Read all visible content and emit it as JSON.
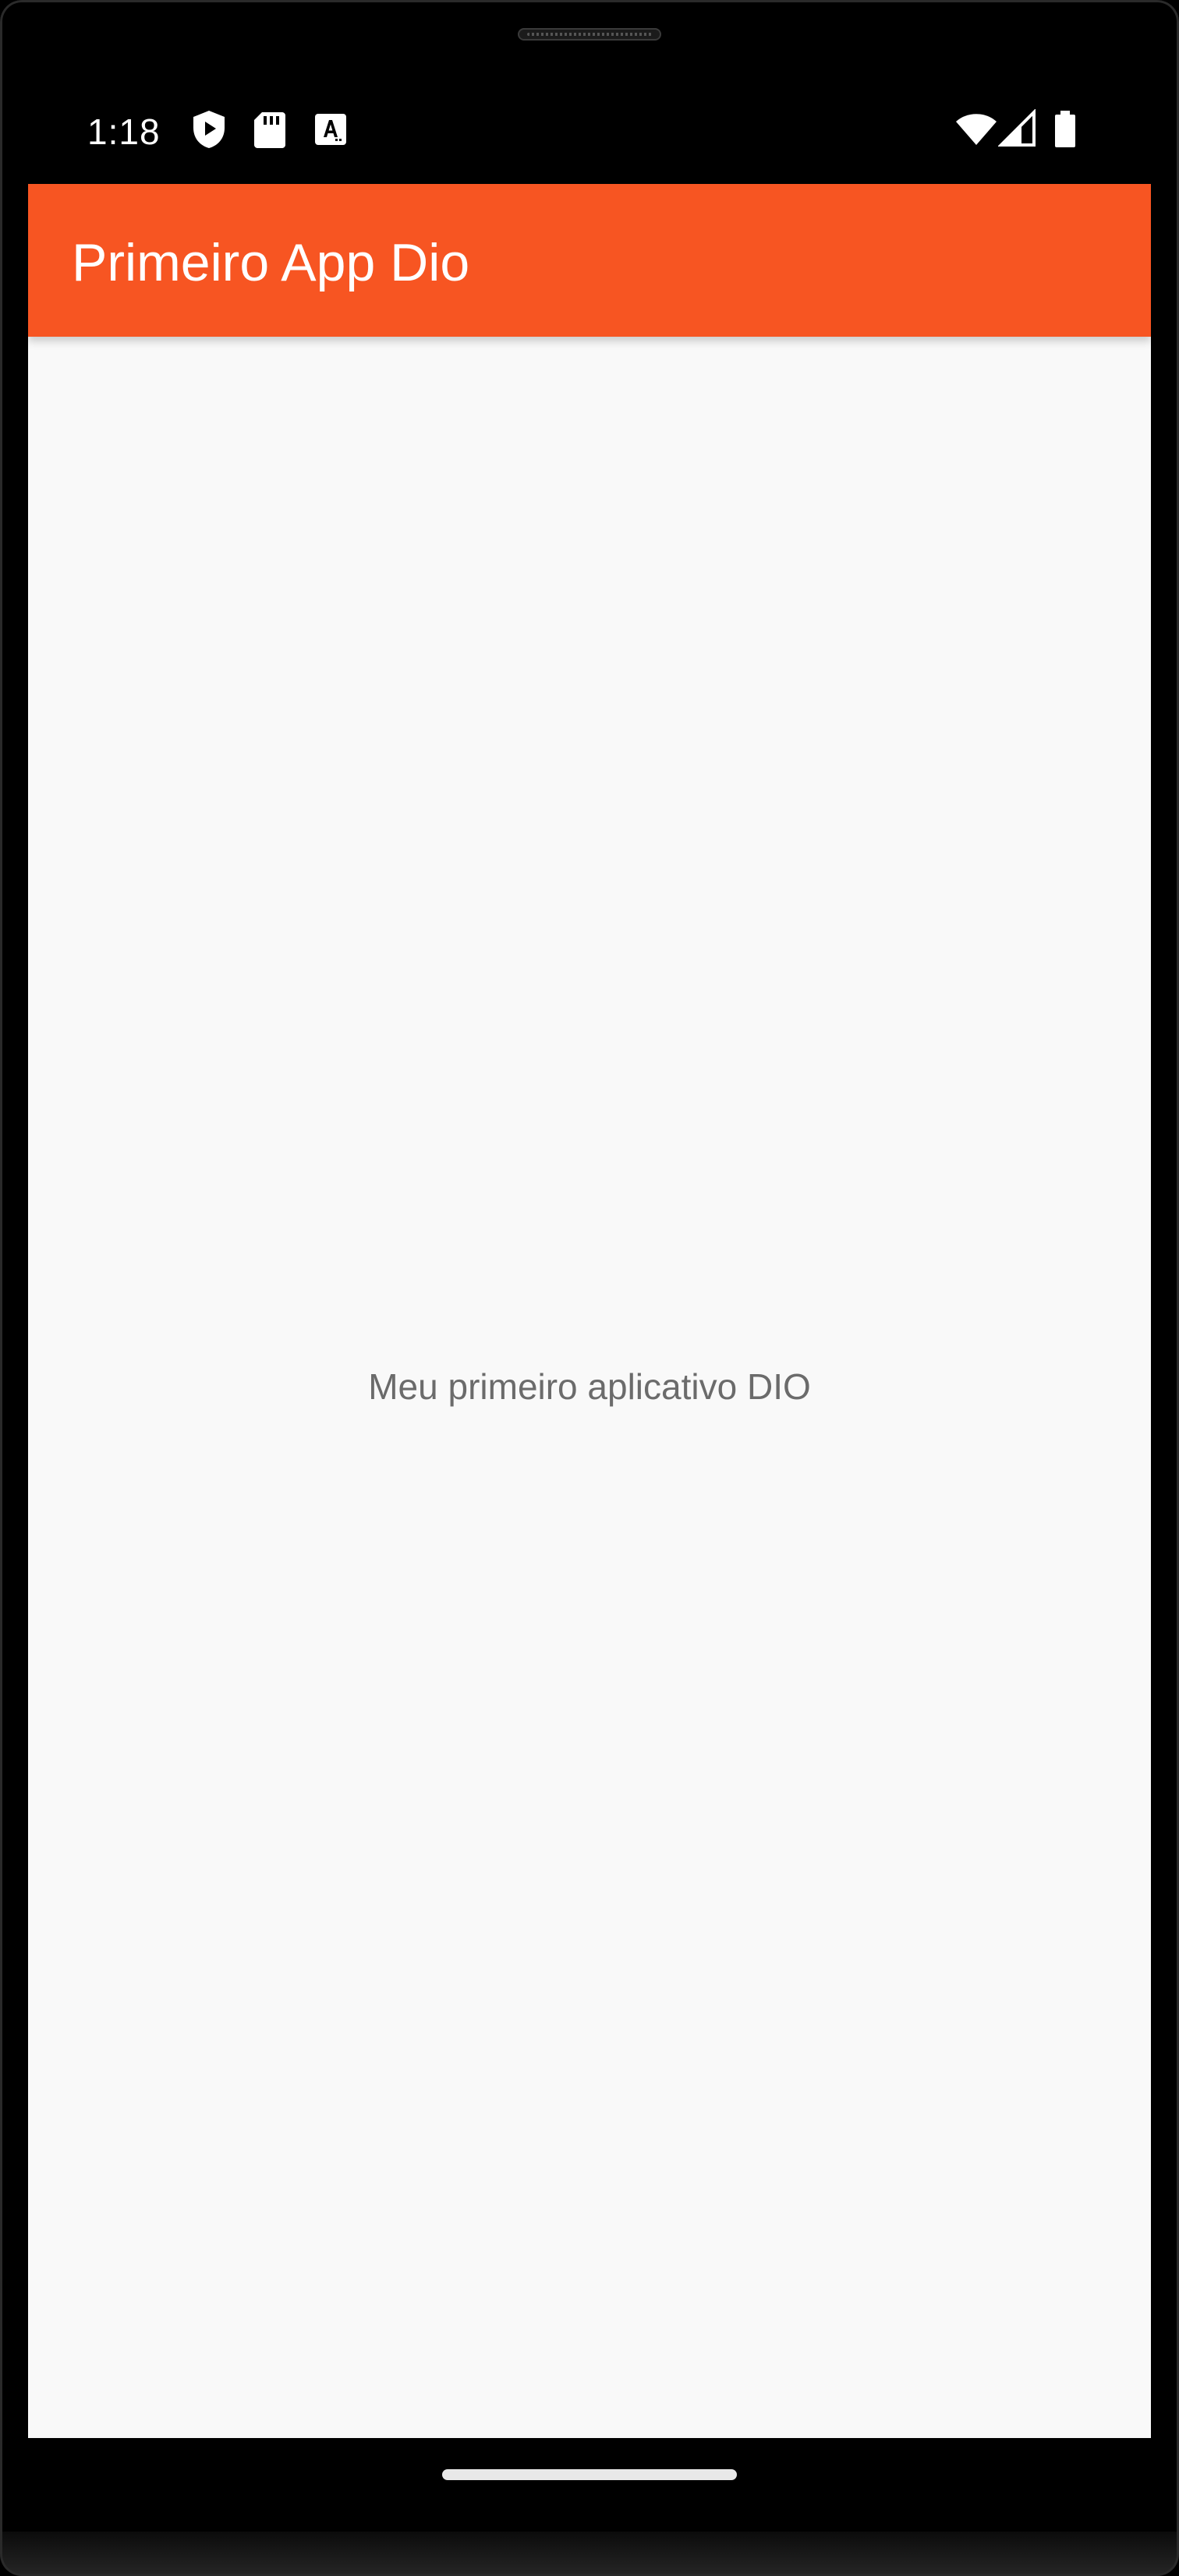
{
  "status_bar": {
    "time": "1:18",
    "left_icons": [
      "play-protect-icon",
      "sd-card-icon",
      "font-a-icon"
    ],
    "right_icons": [
      "wifi-icon",
      "signal-icon",
      "battery-icon"
    ]
  },
  "app_bar": {
    "title": "Primeiro App Dio",
    "color": "#f75522"
  },
  "main": {
    "message": "Meu primeiro aplicativo DIO",
    "background": "#f9f9f9"
  }
}
